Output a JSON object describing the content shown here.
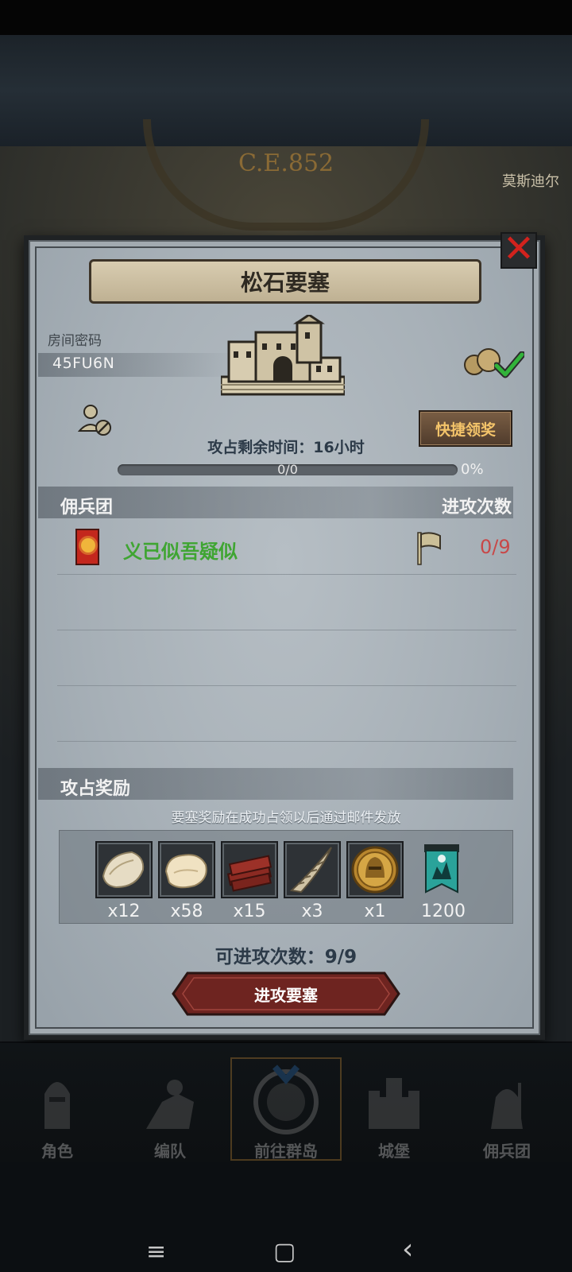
{
  "background": {
    "era_label": "C.E.852",
    "top_right_label": "莫斯迪尔"
  },
  "modal": {
    "title": "松石要塞",
    "room_code_label": "房间密码",
    "room_code": "45FU6N",
    "quick_claim_button": "快捷领奖",
    "timer_text": "攻占剩余时间：16小时",
    "progress": {
      "text": "0/0",
      "percent_text": "0%",
      "fraction": 0
    },
    "mercenary_section": {
      "left_header": "佣兵团",
      "right_header": "进攻次数",
      "rows": [
        {
          "name": "义已似吾疑似",
          "attacks": "0/9"
        }
      ]
    },
    "rewards_section": {
      "header": "攻占奖励",
      "note": "要塞奖励在成功占领以后通过邮件发放",
      "items": [
        {
          "icon": "fur-pelt-icon",
          "qty": "x12"
        },
        {
          "icon": "wool-pelt-icon",
          "qty": "x58"
        },
        {
          "icon": "timber-icon",
          "qty": "x15"
        },
        {
          "icon": "horn-icon",
          "qty": "x3"
        },
        {
          "icon": "knight-coin-icon",
          "qty": "x1"
        },
        {
          "icon": "guild-banner-icon",
          "qty": "1200"
        }
      ]
    },
    "attempts_text": "可进攻次数：9/9",
    "attack_button": "进攻要塞"
  },
  "bottom_nav": {
    "items": [
      {
        "label": "角色",
        "icon": "knight-helmet-icon"
      },
      {
        "label": "编队",
        "icon": "horseman-icon"
      },
      {
        "label": "前往群岛",
        "icon": "compass-icon"
      },
      {
        "label": "城堡",
        "icon": "castle-icon"
      },
      {
        "label": "佣兵团",
        "icon": "mercenary-icon"
      }
    ],
    "active_index": 2
  },
  "system_nav": {
    "recents_icon": "≡",
    "home_icon": "▢",
    "back_icon": "‹"
  },
  "colors": {
    "close_red": "#d2221d",
    "mercenary_green": "#3fa532",
    "attack_count_red": "#c84848",
    "quick_claim_gold": "#f4c46a",
    "attack_button_red": "#6e2420"
  }
}
